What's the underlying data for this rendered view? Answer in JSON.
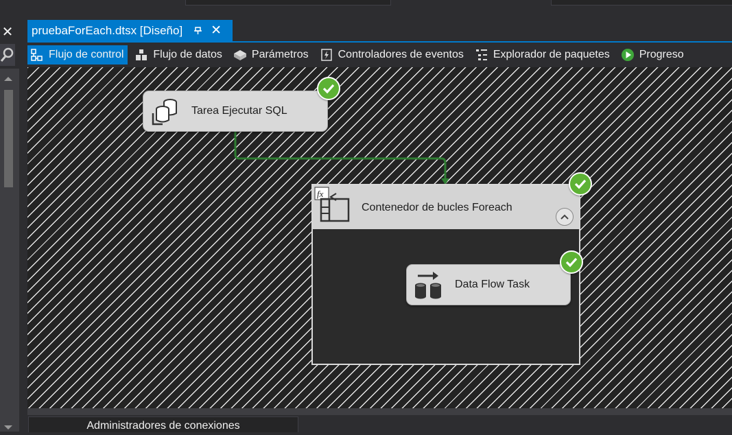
{
  "document_tab": {
    "title": "pruebaForEach.dtsx [Diseño]",
    "pin_icon": "pin-icon",
    "close_icon": "close-icon"
  },
  "toolbar": {
    "items": [
      {
        "label": "Flujo de control",
        "icon": "control-flow-icon",
        "active": true
      },
      {
        "label": "Flujo de datos",
        "icon": "data-flow-icon",
        "active": false
      },
      {
        "label": "Parámetros",
        "icon": "parameters-icon",
        "active": false
      },
      {
        "label": "Controladores de eventos",
        "icon": "event-handlers-icon",
        "active": false
      },
      {
        "label": "Explorador de paquetes",
        "icon": "package-explorer-icon",
        "active": false
      },
      {
        "label": "Progreso",
        "icon": "progress-icon",
        "active": false
      }
    ]
  },
  "canvas": {
    "tasks": [
      {
        "label": "Tarea Ejecutar SQL",
        "icon": "execute-sql-icon",
        "status": "success"
      },
      {
        "label": "Data Flow Task",
        "icon": "data-flow-task-icon",
        "status": "success"
      }
    ],
    "container": {
      "label": "Contenedor de bucles Foreach",
      "icon": "foreach-container-icon",
      "status": "success",
      "collapse_icon": "chevron-up-icon"
    },
    "connector_color": "#2e7d32"
  },
  "connection_managers": {
    "label": "Administradores de conexiones"
  },
  "colors": {
    "accent": "#007acc",
    "success": "#5db234",
    "background": "#2d2d30"
  }
}
